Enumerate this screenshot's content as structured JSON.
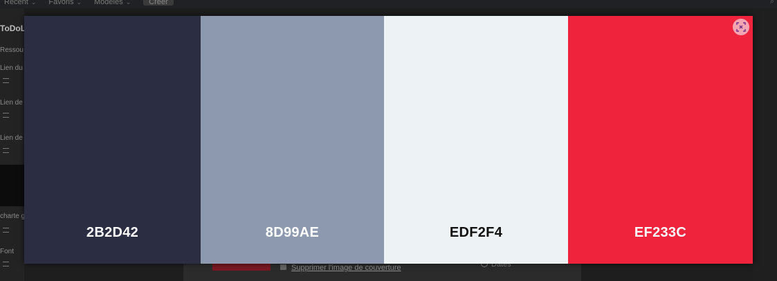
{
  "topbar": {
    "menus": [
      "Récent",
      "Favoris",
      "Modèles"
    ],
    "create_label": "Créer"
  },
  "sidebar": {
    "title": "ToDoL",
    "items": [
      "Ressou",
      "Lien du",
      "Lien de",
      "Lien de",
      "charte g",
      "Font"
    ]
  },
  "bottom": {
    "remove_cover_label": "Supprimer l'image de couverture",
    "dates_label": "Dates"
  },
  "palette": {
    "swatches": [
      {
        "code": "2B2D42",
        "color": "#2B2D42",
        "text_color": "#FFFFFF"
      },
      {
        "code": "8D99AE",
        "color": "#8D99AE",
        "text_color": "#FFFFFF"
      },
      {
        "code": "EDF2F4",
        "color": "#EDF2F4",
        "text_color": "#111111"
      },
      {
        "code": "EF233C",
        "color": "#EF233C",
        "text_color": "#FFFFFF"
      }
    ],
    "close_icon": "scan-close-icon"
  }
}
